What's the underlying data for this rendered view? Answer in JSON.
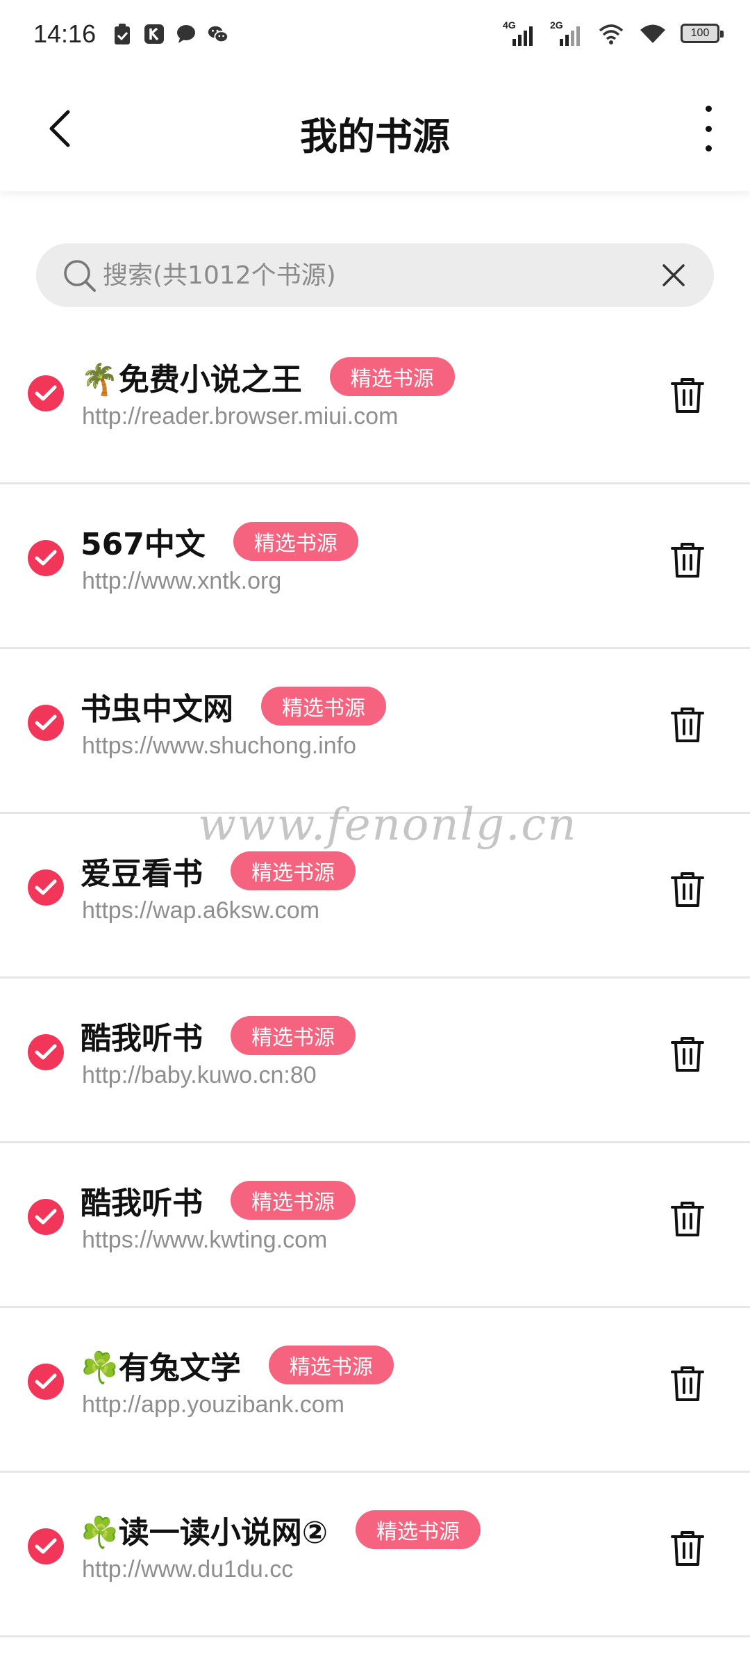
{
  "status_bar": {
    "time": "14:16",
    "left_icons": [
      "clipboard-icon",
      "k-app-icon",
      "message-bubble-icon",
      "wechat-icon"
    ],
    "signal1_label": "4G",
    "signal2_label": "2G",
    "battery": "100"
  },
  "header": {
    "title": "我的书源",
    "back_icon": "chevron-left-icon",
    "more_icon": "more-vertical-icon"
  },
  "search": {
    "placeholder": "搜索(共1012个书源)"
  },
  "badge_label": "精选书源",
  "sources": [
    {
      "name": "🌴免费小说之王",
      "url": "http://reader.browser.miui.com",
      "badge": "精选书源"
    },
    {
      "name": "567中文",
      "url": "http://www.xntk.org",
      "badge": "精选书源"
    },
    {
      "name": "书虫中文网",
      "url": "https://www.shuchong.info",
      "badge": "精选书源"
    },
    {
      "name": "爱豆看书",
      "url": "https://wap.a6ksw.com",
      "badge": "精选书源"
    },
    {
      "name": "酷我听书",
      "url": "http://baby.kuwo.cn:80",
      "badge": "精选书源"
    },
    {
      "name": "酷我听书",
      "url": "https://www.kwting.com",
      "badge": "精选书源"
    },
    {
      "name": "☘️有兔文学",
      "url": "http://app.youzibank.com",
      "badge": "精选书源"
    },
    {
      "name": "☘️读一读小说网②",
      "url": "http://www.du1du.cc",
      "badge": "精选书源"
    }
  ],
  "watermark": "www.fenonlg.cn",
  "colors": {
    "check": "#f2365a",
    "badge": "#f5637e",
    "url": "#8e8e8e"
  }
}
